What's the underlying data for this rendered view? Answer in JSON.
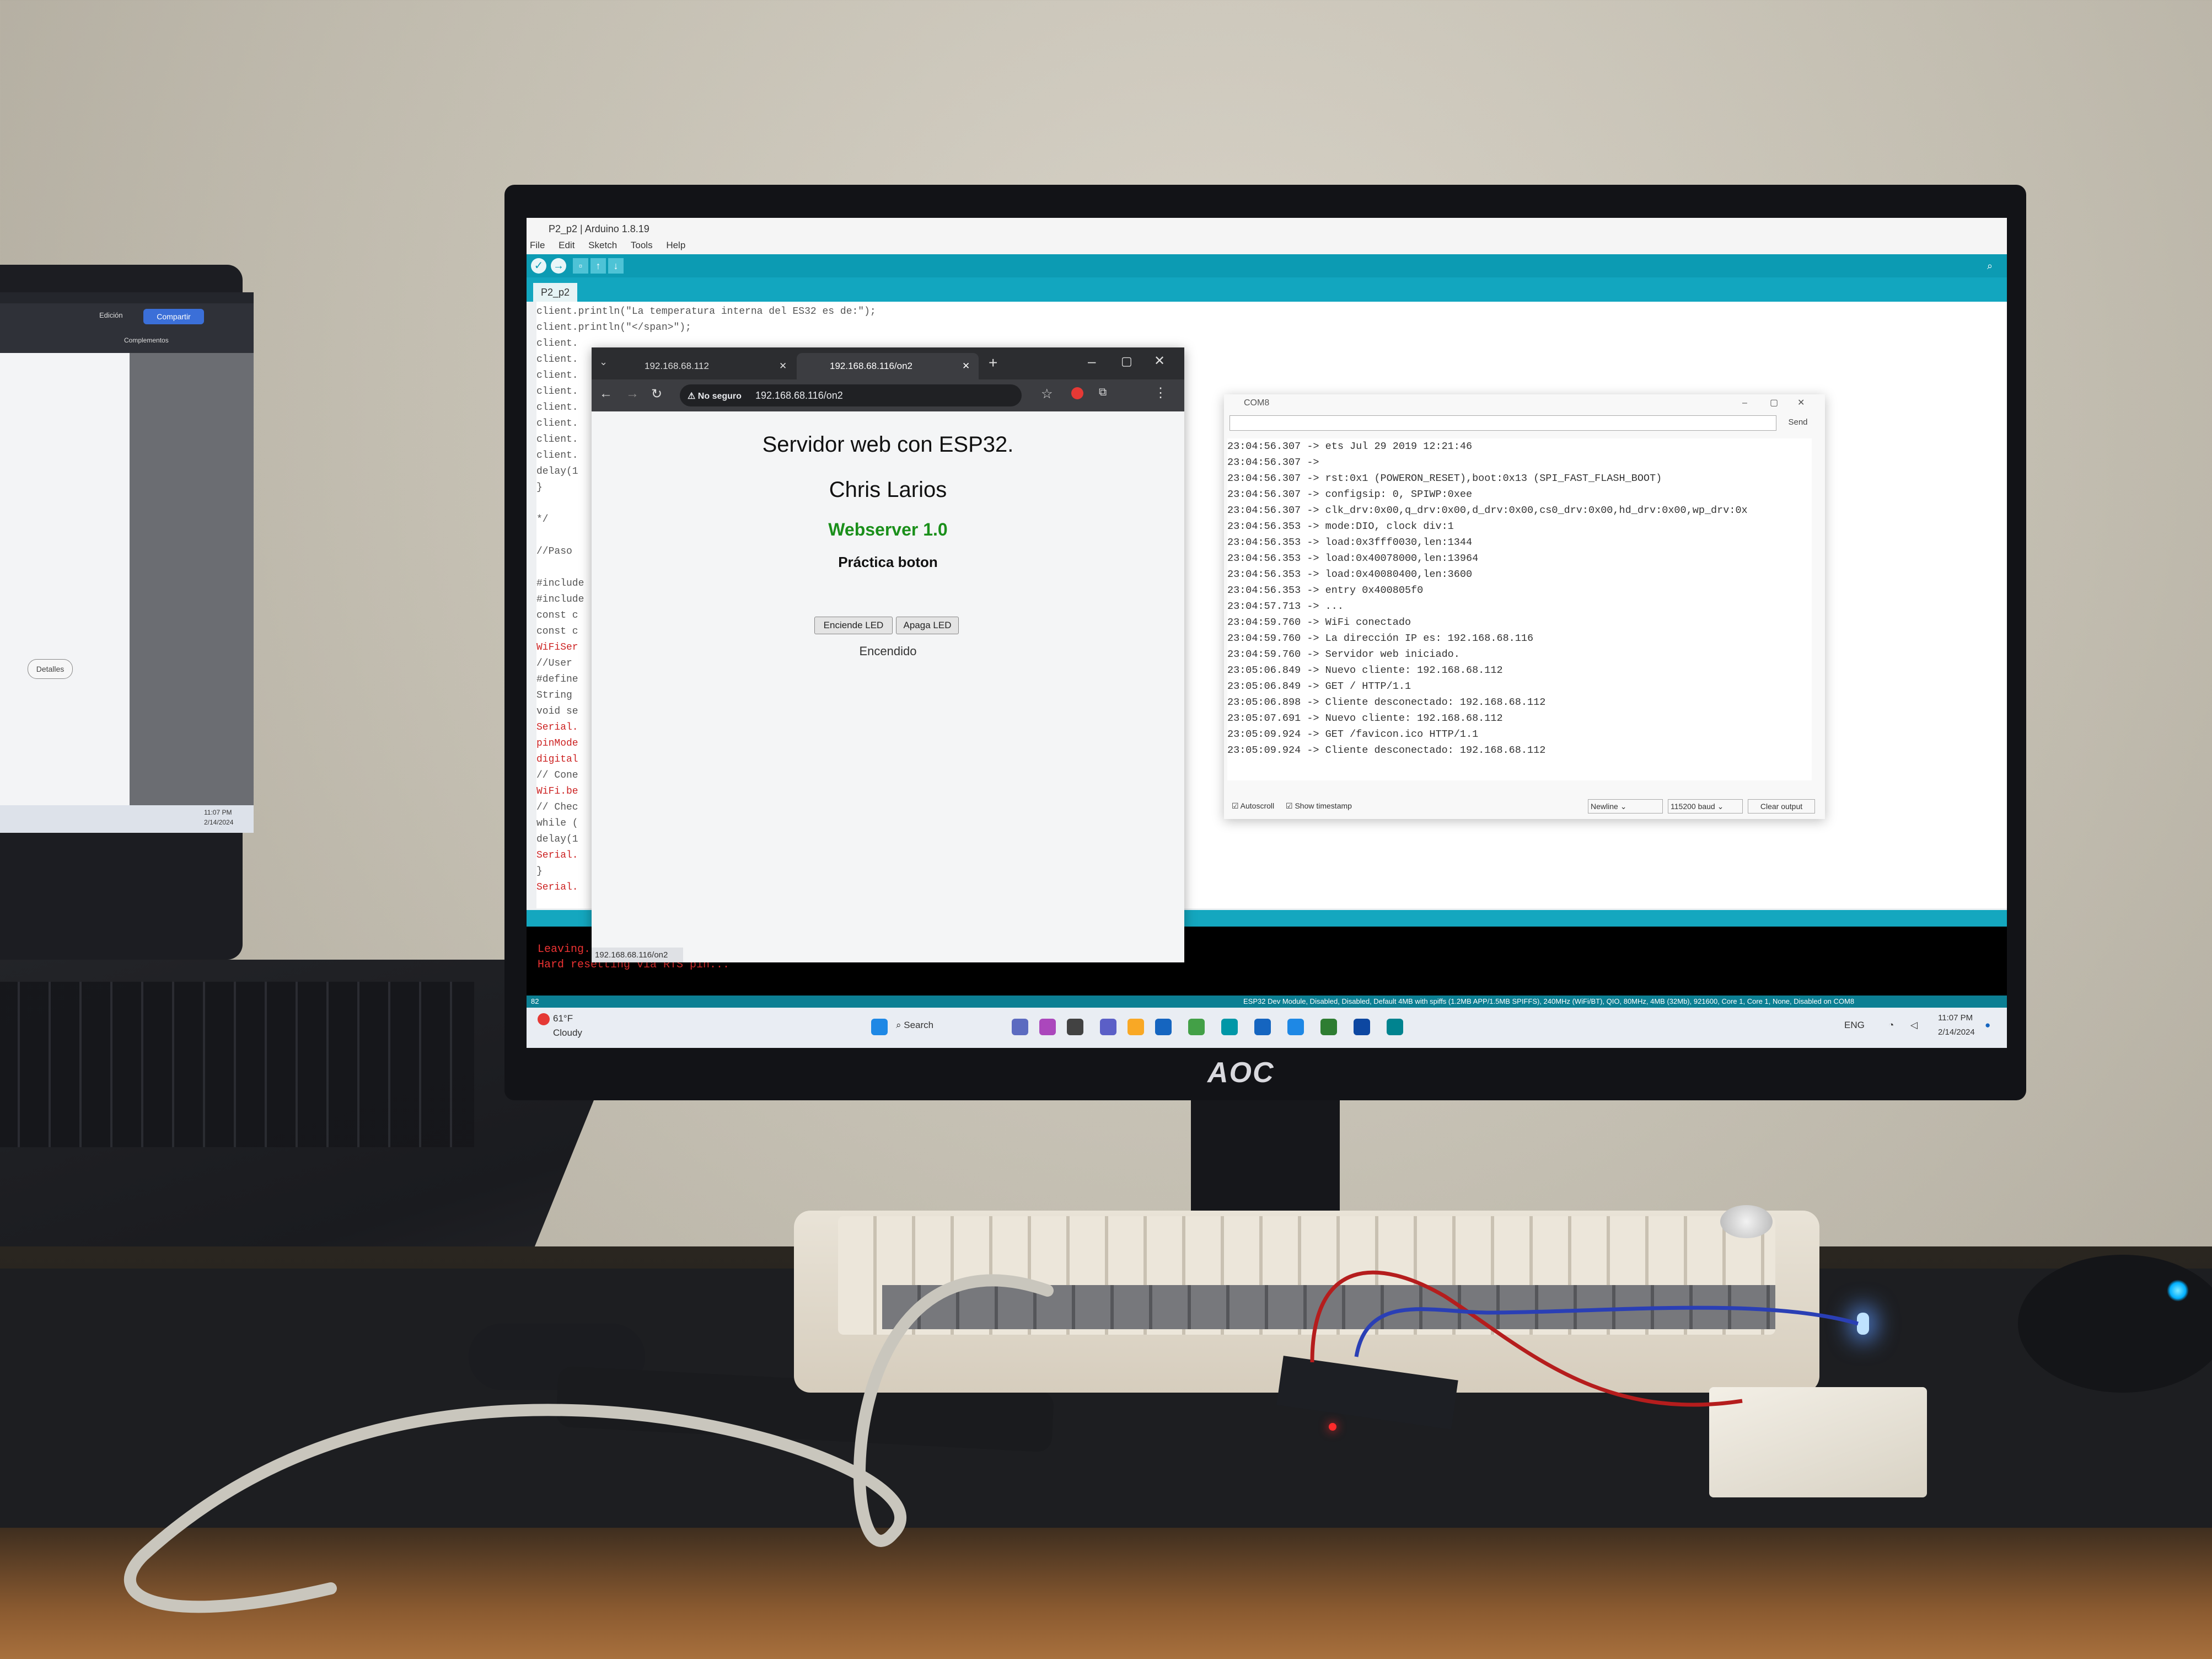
{
  "laptop": {
    "ribbon_button": "Compartir",
    "ribbon_labels": [
      "Edición",
      "Complementos"
    ],
    "details_button": "Detalles",
    "clock_time": "11:07 PM",
    "clock_date": "2/14/2024"
  },
  "monitor": {
    "brand": "AOC"
  },
  "ide": {
    "title": "P2_p2 | Arduino 1.8.19",
    "menu": [
      "File",
      "Edit",
      "Sketch",
      "Tools",
      "Help"
    ],
    "tab": "P2_p2",
    "code_lines": [
      "client.println(\"La temperatura interna del ES32 es de:\");",
      "client.println(\"</span>\");",
      "client.",
      "client.",
      "client.",
      "client.",
      "client.",
      "client.",
      "client.",
      "client.",
      "delay(1",
      "}",
      "",
      "*/",
      "",
      "//Paso",
      "",
      "#include",
      "#include",
      "const c",
      "const c",
      "WiFiSer",
      "//User",
      "#define",
      "String",
      "void se",
      "Serial.",
      "pinMode",
      "digital",
      "// Cone",
      "WiFi.be",
      "// Chec",
      "while (",
      "delay(1",
      "Serial.",
      "}",
      "Serial."
    ],
    "console": [
      "Leaving...",
      "Hard resetting via RTS pin..."
    ],
    "status_line": "82",
    "board_info": "ESP32 Dev Module, Disabled, Disabled, Default 4MB with spiffs (1.2MB APP/1.5MB SPIFFS), 240MHz (WiFi/BT), QIO, 80MHz, 4MB (32Mb), 921600, Core 1, Core 1, None, Disabled on COM8"
  },
  "chrome": {
    "tabs": [
      "192.168.68.112",
      "192.168.68.116/on2"
    ],
    "not_secure": "No seguro",
    "url": "192.168.68.116/on2",
    "status_url": "192.168.68.116/on2",
    "page": {
      "title": "Servidor web con ESP32.",
      "author": "Chris Larios",
      "version": "Webserver 1.0",
      "subtitle": "Práctica boton",
      "btn_on": "Enciende LED",
      "btn_off": "Apaga LED",
      "state": "Encendido"
    }
  },
  "serial": {
    "title": "COM8",
    "send": "Send",
    "lines": [
      "23:04:56.307 -> ets Jul 29 2019 12:21:46",
      "23:04:56.307 ->",
      "23:04:56.307 -> rst:0x1 (POWERON_RESET),boot:0x13 (SPI_FAST_FLASH_BOOT)",
      "23:04:56.307 -> configsip: 0, SPIWP:0xee",
      "23:04:56.307 -> clk_drv:0x00,q_drv:0x00,d_drv:0x00,cs0_drv:0x00,hd_drv:0x00,wp_drv:0x",
      "23:04:56.353 -> mode:DIO, clock div:1",
      "23:04:56.353 -> load:0x3fff0030,len:1344",
      "23:04:56.353 -> load:0x40078000,len:13964",
      "23:04:56.353 -> load:0x40080400,len:3600",
      "23:04:56.353 -> entry 0x400805f0",
      "23:04:57.713 -> ...",
      "23:04:59.760 -> WiFi conectado",
      "23:04:59.760 -> La dirección IP es: 192.168.68.116",
      "23:04:59.760 -> Servidor web iniciado.",
      "23:05:06.849 -> Nuevo cliente: 192.168.68.112",
      "23:05:06.849 -> GET / HTTP/1.1",
      "23:05:06.898 -> Cliente desconectado: 192.168.68.112",
      "23:05:07.691 -> Nuevo cliente: 192.168.68.112",
      "23:05:09.924 -> GET /favicon.ico HTTP/1.1",
      "23:05:09.924 -> Cliente desconectado: 192.168.68.112"
    ],
    "autoscroll": "Autoscroll",
    "show_timestamp": "Show timestamp",
    "line_ending": "Newline",
    "baud": "115200 baud",
    "clear": "Clear output"
  },
  "taskbar": {
    "weather_temp": "61°F",
    "weather_desc": "Cloudy",
    "search": "Search",
    "lang": "ENG",
    "time": "11:07 PM",
    "date": "2/14/2024"
  }
}
